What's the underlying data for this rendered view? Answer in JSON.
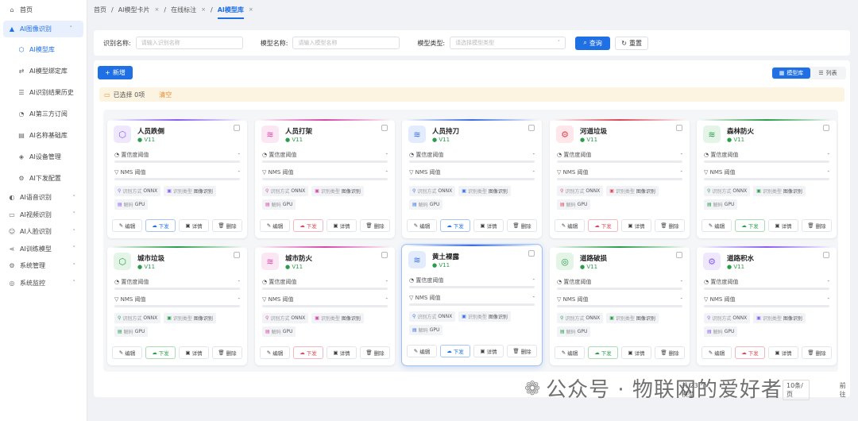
{
  "sidebar": {
    "home": "首页",
    "group": "AI图像识别",
    "subitems": [
      {
        "label": "AI模型库",
        "icon": "cube-icon",
        "active": true
      },
      {
        "label": "AI模型绑定库",
        "icon": "link-icon"
      },
      {
        "label": "AI识别结果历史",
        "icon": "list-icon"
      },
      {
        "label": "AI第三方订阅",
        "icon": "subscribe-icon"
      },
      {
        "label": "AI名称基础库",
        "icon": "db-icon"
      },
      {
        "label": "AI设备管理",
        "icon": "device-icon"
      },
      {
        "label": "AI下发配置",
        "icon": "config-icon"
      }
    ],
    "groups": [
      "AI语音识别",
      "AI视频识别",
      "AI人脸识别",
      "AI训练模型",
      "系统管理",
      "系统监控"
    ]
  },
  "breadcrumb": {
    "items": [
      "首页",
      "AI模型卡片",
      "在线标注"
    ],
    "current": "AI模型库",
    "sep": "/"
  },
  "search": {
    "name_label": "识别名称:",
    "name_placeholder": "请输入识别名称",
    "model_label": "模型名称:",
    "model_placeholder": "请输入模型名称",
    "type_label": "模型类型:",
    "type_placeholder": "请选择模型类型",
    "query_btn": "查询",
    "reset_btn": "重置"
  },
  "toolbar": {
    "add_btn": "新增",
    "view_card": "模型库",
    "view_list": "列表"
  },
  "selection": {
    "text": "已选择 0项",
    "clear": "清空"
  },
  "card_labels": {
    "confidence": "置信度阈值",
    "nms": "NMS 阈值",
    "dash": "-",
    "mode_k": "识别方式",
    "mode_v": "ONNX",
    "type_k": "识别类型",
    "type_v": "图像识别",
    "hw_k": "解码",
    "hw_v": "GPU",
    "edit": "编辑",
    "deploy": "下发",
    "detail": "详情",
    "delete": "删除"
  },
  "cards": [
    {
      "name": "人员跌倒",
      "version": "V11",
      "color": "#8b5cf6",
      "bg": "#efe8fd",
      "glyph": "⬡",
      "deploy": "blue"
    },
    {
      "name": "人员打架",
      "version": "V11",
      "color": "#d946a8",
      "bg": "#fbe6f3",
      "glyph": "≋",
      "deploy": "pink"
    },
    {
      "name": "人员持刀",
      "version": "V11",
      "color": "#3b6fe5",
      "bg": "#e3ecfd",
      "glyph": "≋",
      "deploy": "blue"
    },
    {
      "name": "河道垃圾",
      "version": "V11",
      "color": "#e0475a",
      "bg": "#fde7ea",
      "glyph": "⚙",
      "deploy": "pink"
    },
    {
      "name": "森林防火",
      "version": "V11",
      "color": "#2a9d4a",
      "bg": "#e4f5e8",
      "glyph": "≋",
      "deploy": "green"
    },
    {
      "name": "城市垃圾",
      "version": "V11",
      "color": "#2a9d4a",
      "bg": "#e4f5e8",
      "glyph": "⬡",
      "deploy": "green"
    },
    {
      "name": "城市防火",
      "version": "V11",
      "color": "#d946a8",
      "bg": "#fbe6f3",
      "glyph": "≋",
      "deploy": "pink"
    },
    {
      "name": "黄土裸露",
      "version": "V11",
      "color": "#3b6fe5",
      "bg": "#e3ecfd",
      "glyph": "≋",
      "deploy": "blue"
    },
    {
      "name": "道路破损",
      "version": "V11",
      "color": "#2a9d4a",
      "bg": "#e4f5e8",
      "glyph": "◎",
      "deploy": "green"
    },
    {
      "name": "道路积水",
      "version": "V11",
      "color": "#8b5cf6",
      "bg": "#efe8fd",
      "glyph": "⚙",
      "deploy": "pink"
    }
  ],
  "pager": {
    "total": "共 23 个模型",
    "size": "10条/页",
    "goto": "前往"
  },
  "watermark": "公众号 · 物联网的爱好者"
}
